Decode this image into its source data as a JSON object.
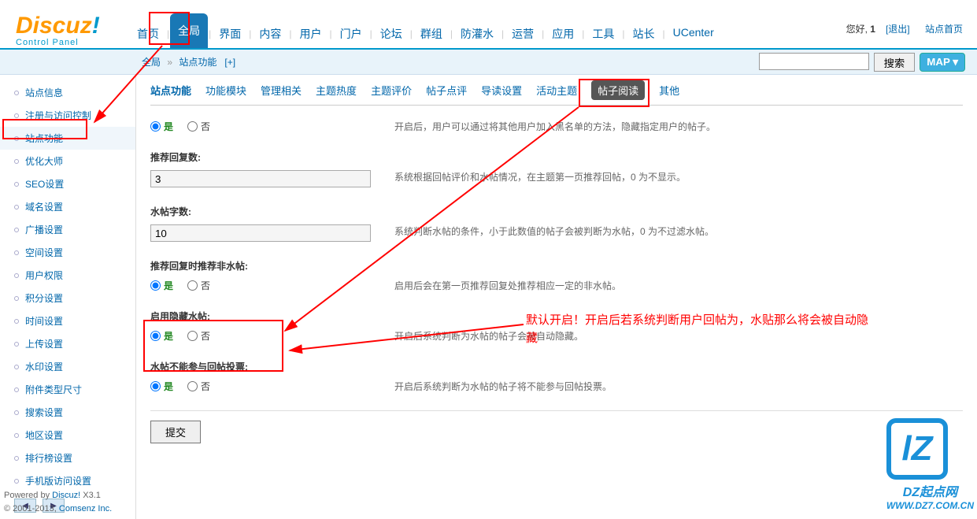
{
  "logo": {
    "main": "Discuz",
    "ex": "!",
    "sub": "Control Panel"
  },
  "main_nav": [
    "首页",
    "全局",
    "界面",
    "内容",
    "用户",
    "门户",
    "论坛",
    "群组",
    "防灌水",
    "运营",
    "应用",
    "工具",
    "站长",
    "UCenter"
  ],
  "main_nav_active_index": 1,
  "header_right": {
    "greeting": "您好, ",
    "user": "1",
    "logout": "[退出]",
    "home": "站点首页"
  },
  "breadcrumb": {
    "p1": "全局",
    "p2": "站点功能",
    "plus": "[+]"
  },
  "search": {
    "btn": "搜索",
    "map": "MAP ▾"
  },
  "sidebar": {
    "items": [
      "站点信息",
      "注册与访问控制",
      "站点功能",
      "优化大师",
      "SEO设置",
      "域名设置",
      "广播设置",
      "空间设置",
      "用户权限",
      "积分设置",
      "时间设置",
      "上传设置",
      "水印设置",
      "附件类型尺寸",
      "搜索设置",
      "地区设置",
      "排行榜设置",
      "手机版访问设置"
    ],
    "active_index": 2,
    "nav_prev": "◀",
    "nav_next": "▶"
  },
  "sub_tabs": [
    "站点功能",
    "功能模块",
    "管理相关",
    "主题热度",
    "主题评价",
    "帖子点评",
    "导读设置",
    "活动主题",
    "帖子阅读",
    "其他"
  ],
  "sub_tab_active_index": 8,
  "form": {
    "f1": {
      "yes": "是",
      "no": "否",
      "desc": "开启后，用户可以通过将其他用户加入黑名单的方法，隐藏指定用户的帖子。"
    },
    "f2": {
      "label": "推荐回复数:",
      "value": "3",
      "desc": "系统根据回帖评价和水帖情况，在主题第一页推荐回帖，0 为不显示。"
    },
    "f3": {
      "label": "水帖字数:",
      "value": "10",
      "desc": "系统判断水帖的条件，小于此数值的帖子会被判断为水帖，0 为不过滤水帖。"
    },
    "f4": {
      "label": "推荐回复时推荐非水帖:",
      "yes": "是",
      "no": "否",
      "desc": "启用后会在第一页推荐回复处推荐相应一定的非水帖。"
    },
    "f5": {
      "label": "启用隐藏水帖:",
      "yes": "是",
      "no": "否",
      "desc": "开启后系统判断为水帖的帖子会被自动隐藏。"
    },
    "f6": {
      "label": "水帖不能参与回帖投票:",
      "yes": "是",
      "no": "否",
      "desc": "开启后系统判断为水帖的帖子将不能参与回帖投票。"
    },
    "submit": "提交"
  },
  "footer": {
    "l1a": "Powered by ",
    "l1b": "Discuz!",
    "l1c": " X3.1",
    "l2a": "© 2001-2013, ",
    "l2b": "Comsenz Inc."
  },
  "annotation": {
    "text": "默认开启！开启后若系统判断用户回帖为，水贴那么将会被自动隐藏"
  },
  "watermark": {
    "logo": "lZ",
    "t1": "DZ起点网",
    "t2": "WWW.DZ7.COM.CN"
  }
}
